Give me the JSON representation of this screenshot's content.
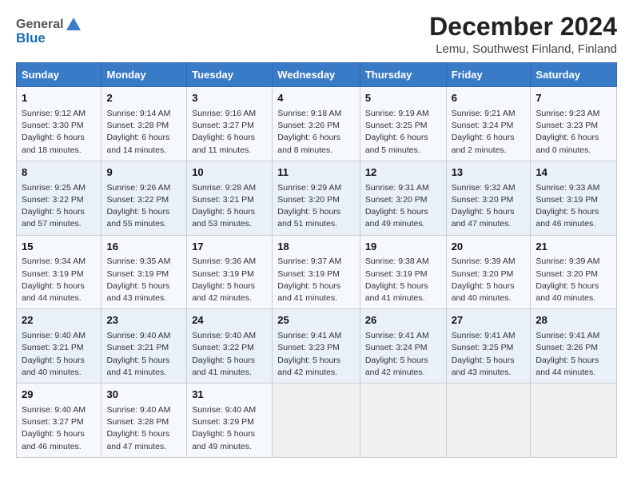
{
  "header": {
    "logo_general": "General",
    "logo_blue": "Blue",
    "title": "December 2024",
    "subtitle": "Lemu, Southwest Finland, Finland"
  },
  "calendar": {
    "days_of_week": [
      "Sunday",
      "Monday",
      "Tuesday",
      "Wednesday",
      "Thursday",
      "Friday",
      "Saturday"
    ],
    "weeks": [
      [
        {
          "day": "1",
          "lines": [
            "Sunrise: 9:12 AM",
            "Sunset: 3:30 PM",
            "Daylight: 6 hours",
            "and 18 minutes."
          ]
        },
        {
          "day": "2",
          "lines": [
            "Sunrise: 9:14 AM",
            "Sunset: 3:28 PM",
            "Daylight: 6 hours",
            "and 14 minutes."
          ]
        },
        {
          "day": "3",
          "lines": [
            "Sunrise: 9:16 AM",
            "Sunset: 3:27 PM",
            "Daylight: 6 hours",
            "and 11 minutes."
          ]
        },
        {
          "day": "4",
          "lines": [
            "Sunrise: 9:18 AM",
            "Sunset: 3:26 PM",
            "Daylight: 6 hours",
            "and 8 minutes."
          ]
        },
        {
          "day": "5",
          "lines": [
            "Sunrise: 9:19 AM",
            "Sunset: 3:25 PM",
            "Daylight: 6 hours",
            "and 5 minutes."
          ]
        },
        {
          "day": "6",
          "lines": [
            "Sunrise: 9:21 AM",
            "Sunset: 3:24 PM",
            "Daylight: 6 hours",
            "and 2 minutes."
          ]
        },
        {
          "day": "7",
          "lines": [
            "Sunrise: 9:23 AM",
            "Sunset: 3:23 PM",
            "Daylight: 6 hours",
            "and 0 minutes."
          ]
        }
      ],
      [
        {
          "day": "8",
          "lines": [
            "Sunrise: 9:25 AM",
            "Sunset: 3:22 PM",
            "Daylight: 5 hours",
            "and 57 minutes."
          ]
        },
        {
          "day": "9",
          "lines": [
            "Sunrise: 9:26 AM",
            "Sunset: 3:22 PM",
            "Daylight: 5 hours",
            "and 55 minutes."
          ]
        },
        {
          "day": "10",
          "lines": [
            "Sunrise: 9:28 AM",
            "Sunset: 3:21 PM",
            "Daylight: 5 hours",
            "and 53 minutes."
          ]
        },
        {
          "day": "11",
          "lines": [
            "Sunrise: 9:29 AM",
            "Sunset: 3:20 PM",
            "Daylight: 5 hours",
            "and 51 minutes."
          ]
        },
        {
          "day": "12",
          "lines": [
            "Sunrise: 9:31 AM",
            "Sunset: 3:20 PM",
            "Daylight: 5 hours",
            "and 49 minutes."
          ]
        },
        {
          "day": "13",
          "lines": [
            "Sunrise: 9:32 AM",
            "Sunset: 3:20 PM",
            "Daylight: 5 hours",
            "and 47 minutes."
          ]
        },
        {
          "day": "14",
          "lines": [
            "Sunrise: 9:33 AM",
            "Sunset: 3:19 PM",
            "Daylight: 5 hours",
            "and 46 minutes."
          ]
        }
      ],
      [
        {
          "day": "15",
          "lines": [
            "Sunrise: 9:34 AM",
            "Sunset: 3:19 PM",
            "Daylight: 5 hours",
            "and 44 minutes."
          ]
        },
        {
          "day": "16",
          "lines": [
            "Sunrise: 9:35 AM",
            "Sunset: 3:19 PM",
            "Daylight: 5 hours",
            "and 43 minutes."
          ]
        },
        {
          "day": "17",
          "lines": [
            "Sunrise: 9:36 AM",
            "Sunset: 3:19 PM",
            "Daylight: 5 hours",
            "and 42 minutes."
          ]
        },
        {
          "day": "18",
          "lines": [
            "Sunrise: 9:37 AM",
            "Sunset: 3:19 PM",
            "Daylight: 5 hours",
            "and 41 minutes."
          ]
        },
        {
          "day": "19",
          "lines": [
            "Sunrise: 9:38 AM",
            "Sunset: 3:19 PM",
            "Daylight: 5 hours",
            "and 41 minutes."
          ]
        },
        {
          "day": "20",
          "lines": [
            "Sunrise: 9:39 AM",
            "Sunset: 3:20 PM",
            "Daylight: 5 hours",
            "and 40 minutes."
          ]
        },
        {
          "day": "21",
          "lines": [
            "Sunrise: 9:39 AM",
            "Sunset: 3:20 PM",
            "Daylight: 5 hours",
            "and 40 minutes."
          ]
        }
      ],
      [
        {
          "day": "22",
          "lines": [
            "Sunrise: 9:40 AM",
            "Sunset: 3:21 PM",
            "Daylight: 5 hours",
            "and 40 minutes."
          ]
        },
        {
          "day": "23",
          "lines": [
            "Sunrise: 9:40 AM",
            "Sunset: 3:21 PM",
            "Daylight: 5 hours",
            "and 41 minutes."
          ]
        },
        {
          "day": "24",
          "lines": [
            "Sunrise: 9:40 AM",
            "Sunset: 3:22 PM",
            "Daylight: 5 hours",
            "and 41 minutes."
          ]
        },
        {
          "day": "25",
          "lines": [
            "Sunrise: 9:41 AM",
            "Sunset: 3:23 PM",
            "Daylight: 5 hours",
            "and 42 minutes."
          ]
        },
        {
          "day": "26",
          "lines": [
            "Sunrise: 9:41 AM",
            "Sunset: 3:24 PM",
            "Daylight: 5 hours",
            "and 42 minutes."
          ]
        },
        {
          "day": "27",
          "lines": [
            "Sunrise: 9:41 AM",
            "Sunset: 3:25 PM",
            "Daylight: 5 hours",
            "and 43 minutes."
          ]
        },
        {
          "day": "28",
          "lines": [
            "Sunrise: 9:41 AM",
            "Sunset: 3:26 PM",
            "Daylight: 5 hours",
            "and 44 minutes."
          ]
        }
      ],
      [
        {
          "day": "29",
          "lines": [
            "Sunrise: 9:40 AM",
            "Sunset: 3:27 PM",
            "Daylight: 5 hours",
            "and 46 minutes."
          ]
        },
        {
          "day": "30",
          "lines": [
            "Sunrise: 9:40 AM",
            "Sunset: 3:28 PM",
            "Daylight: 5 hours",
            "and 47 minutes."
          ]
        },
        {
          "day": "31",
          "lines": [
            "Sunrise: 9:40 AM",
            "Sunset: 3:29 PM",
            "Daylight: 5 hours",
            "and 49 minutes."
          ]
        },
        null,
        null,
        null,
        null
      ]
    ]
  }
}
